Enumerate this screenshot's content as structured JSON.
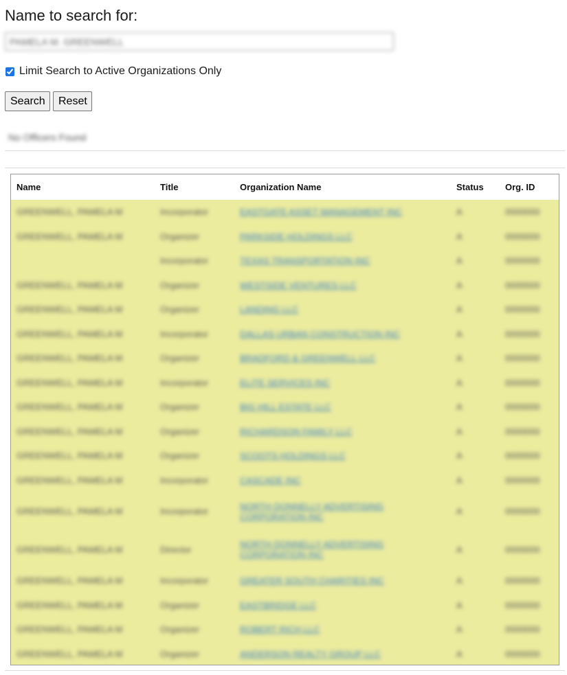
{
  "page": {
    "title": "Name to search for:",
    "search_value": "PAMELA M. GREENWELL",
    "active_only_label": "Limit Search to Active Organizations Only",
    "active_only_checked": true,
    "search_button": "Search",
    "reset_button": "Reset",
    "status_message": "No Officers Found"
  },
  "table": {
    "headers": [
      "Name",
      "Title",
      "Organization Name",
      "Status",
      "Org. ID"
    ],
    "rows": [
      {
        "name": "GREENWELL, PAMELA M",
        "title": "Incorporator",
        "org": "EASTGATE ASSET MANAGEMENT INC",
        "status": "A",
        "org_id": "0000000"
      },
      {
        "name": "GREENWELL, PAMELA M",
        "title": "Organizer",
        "org": "PARKSIDE HOLDINGS LLC",
        "status": "A",
        "org_id": "0000000"
      },
      {
        "name": "",
        "title": "Incorporator",
        "org": "TEXAS TRANSPORTATION INC",
        "status": "A",
        "org_id": "0000000"
      },
      {
        "name": "GREENWELL, PAMELA M",
        "title": "Organizer",
        "org": "WESTSIDE VENTURES LLC",
        "status": "A",
        "org_id": "0000000"
      },
      {
        "name": "GREENWELL, PAMELA M",
        "title": "Organizer",
        "org": "LANDING LLC",
        "status": "A",
        "org_id": "0000000"
      },
      {
        "name": "GREENWELL, PAMELA M",
        "title": "Incorporator",
        "org": "DALLAS URBAN CONSTRUCTION INC",
        "status": "A",
        "org_id": "0000000"
      },
      {
        "name": "GREENWELL, PAMELA M",
        "title": "Organizer",
        "org": "BRADFORD & GREENWELL LLC",
        "status": "A",
        "org_id": "0000000"
      },
      {
        "name": "GREENWELL, PAMELA M",
        "title": "Incorporator",
        "org": "ELITE SERVICES INC",
        "status": "A",
        "org_id": "0000000"
      },
      {
        "name": "GREENWELL, PAMELA M",
        "title": "Organizer",
        "org": "BIG HILL ESTATE LLC",
        "status": "A",
        "org_id": "0000000"
      },
      {
        "name": "GREENWELL, PAMELA M",
        "title": "Organizer",
        "org": "RICHARDSON FAMILY LLC",
        "status": "A",
        "org_id": "0000000"
      },
      {
        "name": "GREENWELL, PAMELA M",
        "title": "Organizer",
        "org": "SCOOTS HOLDINGS LLC",
        "status": "A",
        "org_id": "0000000"
      },
      {
        "name": "GREENWELL, PAMELA M",
        "title": "Incorporator",
        "org": "CASCADE INC",
        "status": "A",
        "org_id": "0000000"
      },
      {
        "name": "GREENWELL, PAMELA M",
        "title": "Incorporator",
        "org": "NORTH DONNELLY ADVERTISING CORPORATION INC",
        "status": "A",
        "org_id": "0000000",
        "tall": true
      },
      {
        "name": "GREENWELL, PAMELA M",
        "title": "Director",
        "org": "NORTH DONNELLY ADVERTISING CORPORATION INC",
        "status": "A",
        "org_id": "0000000",
        "tall": true
      },
      {
        "name": "GREENWELL, PAMELA M",
        "title": "Incorporator",
        "org": "GREATER SOUTH CHARITIES INC",
        "status": "A",
        "org_id": "0000000"
      },
      {
        "name": "GREENWELL, PAMELA M",
        "title": "Organizer",
        "org": "EASTBRIDGE LLC",
        "status": "A",
        "org_id": "0000000"
      },
      {
        "name": "GREENWELL, PAMELA M",
        "title": "Organizer",
        "org": "ROBERT RICH LLC",
        "status": "A",
        "org_id": "0000000"
      },
      {
        "name": "GREENWELL, PAMELA M",
        "title": "Organizer",
        "org": "ANDERSON REALTY GROUP LLC",
        "status": "A",
        "org_id": "0000000"
      }
    ]
  },
  "colors": {
    "table_bg": "#ecec9f",
    "link": "#3a7fc4",
    "checkbox_accent": "#1a73e8"
  }
}
